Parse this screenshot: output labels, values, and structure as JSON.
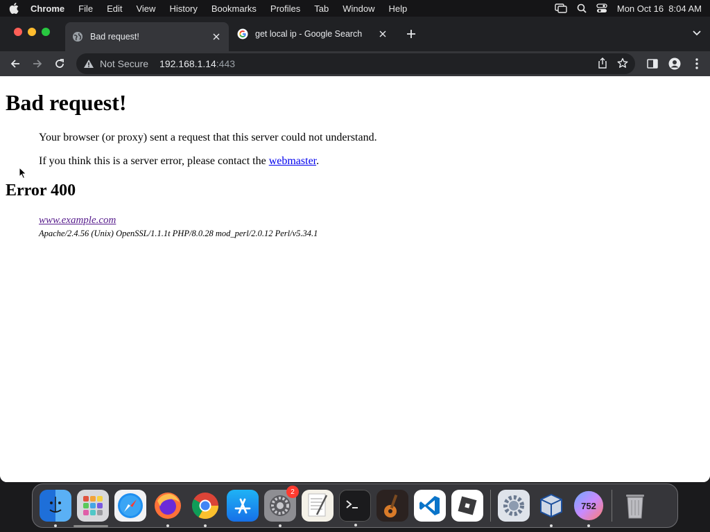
{
  "menubar": {
    "app_name": "Chrome",
    "items": [
      "File",
      "Edit",
      "View",
      "History",
      "Bookmarks",
      "Profiles",
      "Tab",
      "Window",
      "Help"
    ],
    "datetime": "Mon Oct 16  8:04 AM"
  },
  "tabs": [
    {
      "title": "Bad request!",
      "active": true
    },
    {
      "title": "get local ip - Google Search",
      "active": false
    }
  ],
  "omnibox": {
    "security_label": "Not Secure",
    "host": "192.168.1.14",
    "port": ":443"
  },
  "page": {
    "heading": "Bad request!",
    "message": "Your browser (or proxy) sent a request that this server could not understand.",
    "contact_prefix": "If you think this is a server error, please contact the ",
    "contact_link": "webmaster",
    "contact_suffix": ".",
    "error_heading": "Error 400",
    "server_address": "www.example.com",
    "server_signature": "Apache/2.4.56 (Unix) OpenSSL/1.1.1t PHP/8.0.28 mod_perl/2.0.12 Perl/v5.34.1"
  },
  "dock": {
    "system_settings_badge": "2",
    "app_badge_number": "752"
  }
}
